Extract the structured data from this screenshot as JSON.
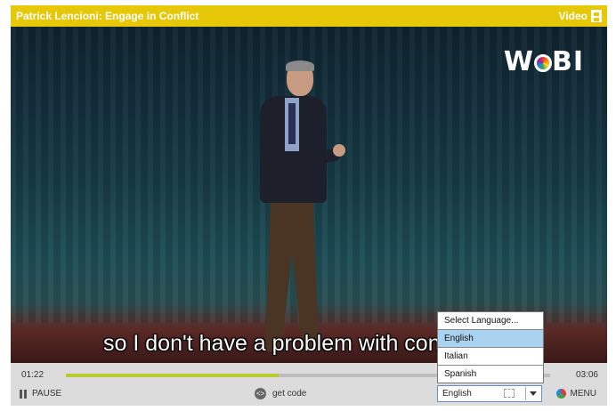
{
  "header": {
    "title": "Patrick Lencioni: Engage in Conflict",
    "category": "Video"
  },
  "video": {
    "logo_text_left": "W",
    "logo_text_right": "BI",
    "subtitle": "so I don't have a problem with con          ?"
  },
  "controls": {
    "current_time": "01:22",
    "duration": "03:06",
    "progress_percent": 44,
    "pause_label": "PAUSE",
    "getcode_label": "get code",
    "language_value": "English",
    "menu_label": "MENU"
  },
  "language_dropdown": {
    "options": [
      "Select Language...",
      "English",
      "Italian",
      "Spanish"
    ],
    "selected_index": 1
  },
  "colors": {
    "title_bar": "#e6c808",
    "progress": "#b7cc2e",
    "selection": "#a9d2f0"
  }
}
